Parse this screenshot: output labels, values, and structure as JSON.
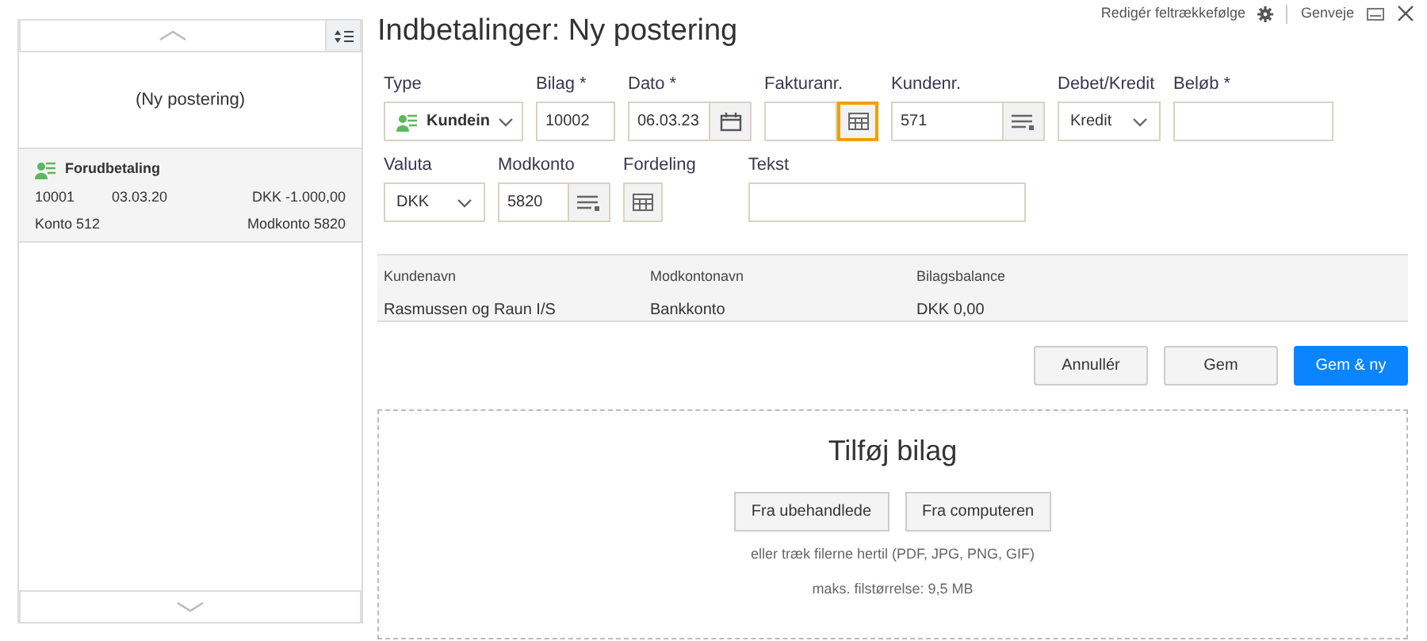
{
  "header": {
    "edit_order": "Redigér feltrækkefølge",
    "shortcuts": "Genveje"
  },
  "sidebar": {
    "new_entry": "(Ny postering)",
    "entries": [
      {
        "type": "Forudbetaling",
        "number": "10001",
        "date": "03.03.20",
        "amount": "DKK -1.000,00",
        "account": "Konto 512",
        "contra": "Modkonto 5820"
      }
    ]
  },
  "title": "Indbetalinger: Ny postering",
  "form_rows": [
    [
      {
        "kind": "select",
        "label": "Type",
        "value": "Kundein",
        "icon": true
      },
      {
        "kind": "input",
        "label": "Bilag *",
        "value": "10002"
      },
      {
        "kind": "input-button",
        "label": "Dato *",
        "value": "06.03.23",
        "focused": false
      },
      {
        "kind": "input-button",
        "label": "Fakturanr.",
        "focused": true
      },
      {
        "kind": "input-button",
        "label": "Kundenr.",
        "value": "571",
        "focused": false
      },
      {
        "kind": "select",
        "label": "Debet/Kredit",
        "value": "Kredit"
      },
      {
        "kind": "input",
        "label": "Beløb *"
      }
    ],
    [
      {
        "kind": "select",
        "label": "Valuta",
        "value": "DKK"
      },
      {
        "kind": "input-button",
        "label": "Modkonto",
        "value": "5820",
        "focused": false
      },
      {
        "kind": "button",
        "label": "Fordeling"
      },
      {
        "kind": "input",
        "label": "Tekst"
      }
    ]
  ],
  "summary": [
    {
      "label": "Kundenavn",
      "value": "Rasmussen og Raun I/S"
    },
    {
      "label": "Modkontonavn",
      "value": "Bankkonto"
    },
    {
      "label": "Bilagsbalance",
      "value": "DKK 0,00"
    }
  ],
  "actions": [
    {
      "label": "Annullér",
      "primary": false
    },
    {
      "label": "Gem",
      "primary": false
    },
    {
      "label": "Gem & ny",
      "primary": true
    }
  ],
  "attach": {
    "title": "Tilføj bilag",
    "buttons": [
      "Fra ubehandlede",
      "Fra computeren"
    ],
    "hint": "eller træk filerne hertil (PDF, JPG, PNG, GIF)",
    "limit": "maks. filstørrelse: 9,5 MB"
  }
}
